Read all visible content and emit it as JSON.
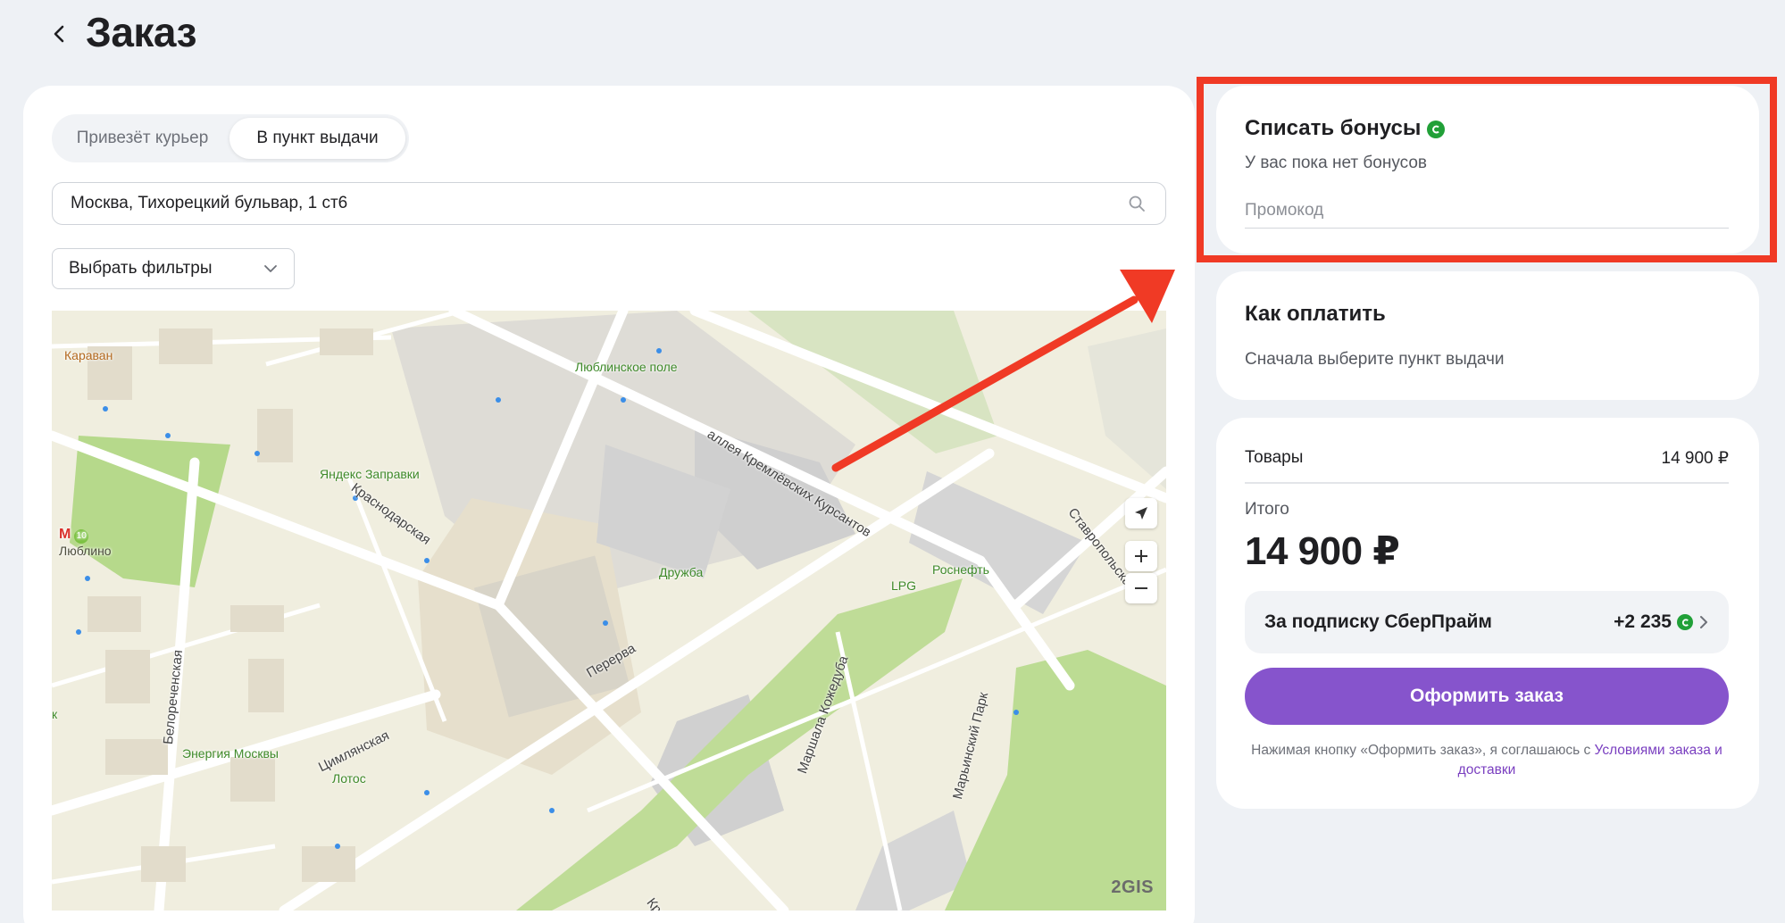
{
  "header": {
    "title": "Заказ"
  },
  "delivery": {
    "options": [
      "Привезёт курьер",
      "В пункт выдачи"
    ],
    "selected": "В пункт выдачи"
  },
  "address": {
    "value": "Москва, Тихорецкий бульвар, 1 ст6"
  },
  "filter": {
    "label": "Выбрать фильтры"
  },
  "map": {
    "attribution": "2GIS",
    "labels": {
      "karavan": "Караван",
      "lublinskoe_pole": "Люблинское поле",
      "alleya": "аллея Кремлёвских Курсантов",
      "yandex": "Яндекс Заправки",
      "metro_line": "10",
      "metro": "Люблино",
      "krasnodarskaya": "Краснодарская",
      "druzhba": "Дружба",
      "stavropolskaya": "Ставропольская",
      "lpg": "LPG",
      "rosneft": "Роснефть",
      "belorechenskaya": "Белореченская",
      "pererva": "Перерва",
      "marshala": "Маршала Кожедуба",
      "marinsky": "Марьинский Парк",
      "tsimlyanskaya": "Цимлянская",
      "energiya": "Энергия Москвы",
      "lotos": "Лотос",
      "k_letter": "к",
      "kras_bottom": "Крас"
    }
  },
  "bonus": {
    "title": "Списать бонусы",
    "subtitle": "У вас пока нет бонусов",
    "promo_placeholder": "Промокод",
    "icon": "sber-bonus-icon",
    "icon_color": "#21a038"
  },
  "payment": {
    "title": "Как оплатить",
    "subtitle": "Сначала выберите пункт выдачи"
  },
  "summary": {
    "goods_label": "Товары",
    "goods_value": "14 900 ₽",
    "total_label": "Итого",
    "total_value": "14 900 ₽",
    "prime_label": "За подписку СберПрайм",
    "prime_value": "+2 235",
    "checkout_label": "Оформить заказ",
    "checkout_color": "#8654cc",
    "terms_text": "Нажимая кнопку «Оформить заказ», я соглашаюсь с ",
    "terms_link": "Условиями заказа и доставки"
  },
  "annotation": {
    "color": "#f03a25"
  }
}
